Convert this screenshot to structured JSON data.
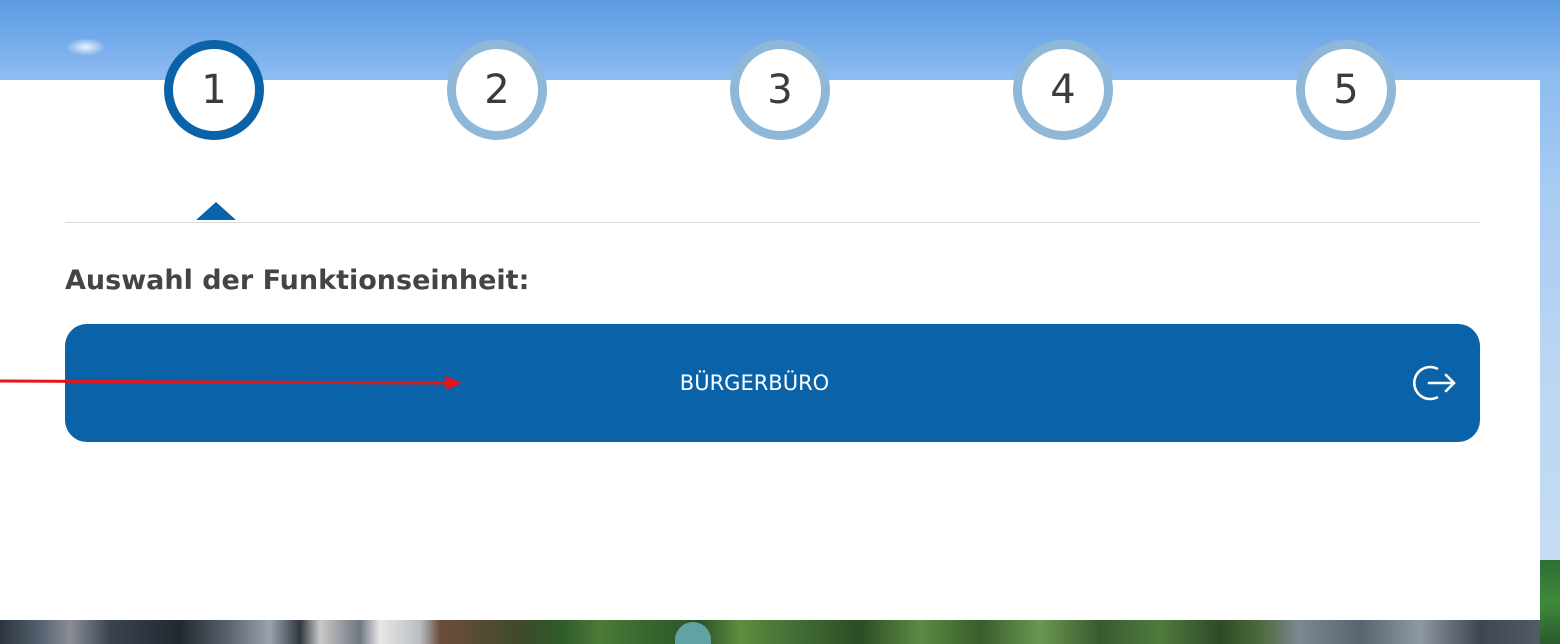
{
  "steps": [
    {
      "number": "1",
      "active": true
    },
    {
      "number": "2",
      "active": false
    },
    {
      "number": "3",
      "active": false
    },
    {
      "number": "4",
      "active": false
    },
    {
      "number": "5",
      "active": false
    }
  ],
  "section": {
    "title": "Auswahl der Funktionseinheit:"
  },
  "unit_button": {
    "label": "BÜRGERBÜRO",
    "icon": "login-arrow-icon"
  },
  "colors": {
    "primary": "#0a63a8",
    "step_inactive": "#8fb8d8",
    "annotation": "#e3161b",
    "title_text": "#444444"
  }
}
